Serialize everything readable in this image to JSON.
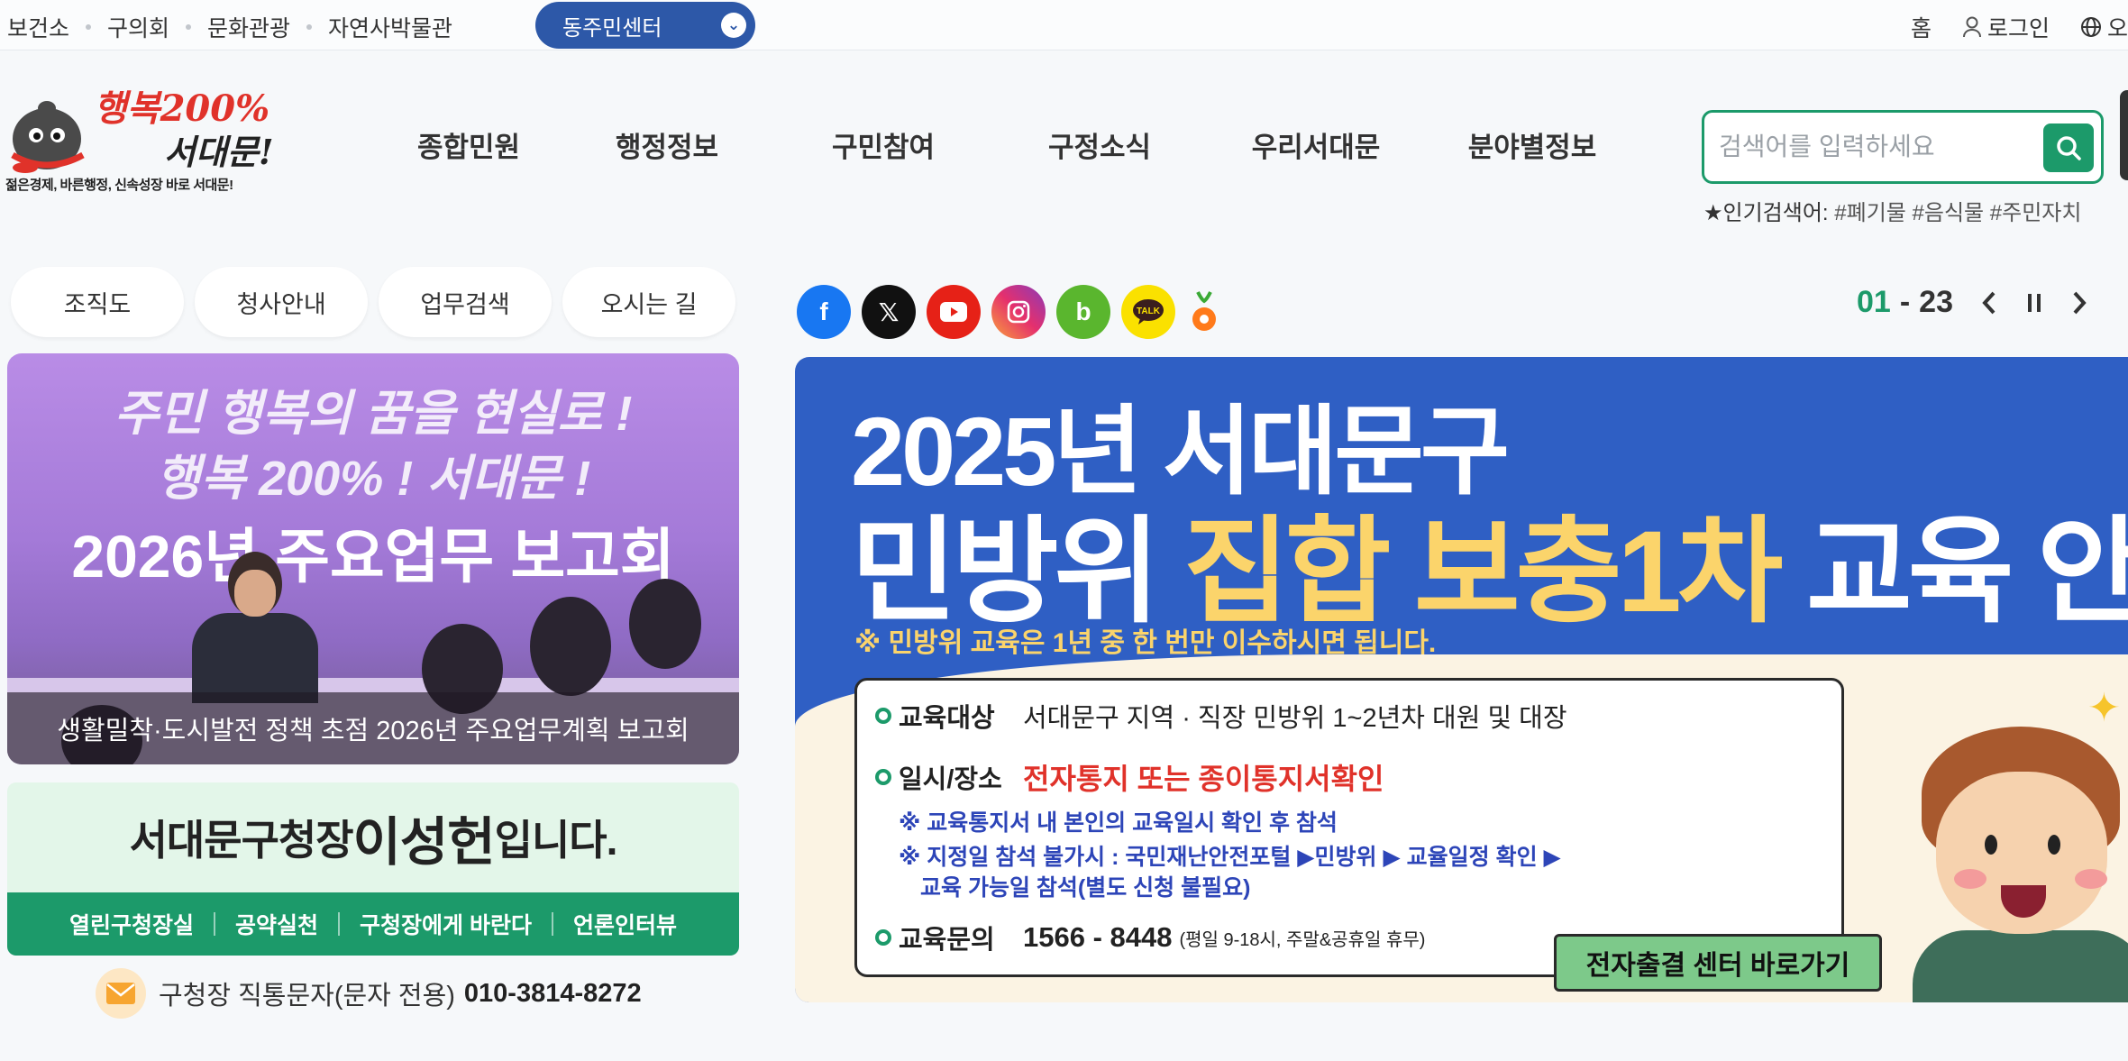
{
  "topbar": {
    "links": [
      "보건소",
      "구의회",
      "문화관광",
      "자연사박물관"
    ],
    "site_select": "동주민센터",
    "home": "홈",
    "login": "로그인",
    "lang": "오"
  },
  "header": {
    "logo_line1": "행복200%",
    "logo_line2": "서대문!",
    "logo_line3": "젊은경제, 바른행정, 신속성장 바로 서대문!",
    "menu": [
      "종합민원",
      "행정정보",
      "구민참여",
      "구정소식",
      "우리서대문",
      "분야별정보"
    ],
    "search_placeholder": "검색어를 입력하세요",
    "popular_label": "★인기검색어:",
    "popular_tags": "#폐기물 #음식물 #주민자치"
  },
  "quick": [
    "조직도",
    "청사안내",
    "업무검색",
    "오시는 길"
  ],
  "photo": {
    "banner1": "주민 행복의 꿈을 현실로 !",
    "banner2": "행복 200% ! 서대문 !",
    "banner3": "2026년 주요업무 보고회",
    "caption": "생활밀착·도시발전 정책 초점 2026년 주요업무계획 보고회"
  },
  "mayor": {
    "prefix": "서대문구청장 ",
    "name": "이성헌",
    "suffix": "입니다.",
    "links": [
      "열린구청장실",
      "공약실천",
      "구청장에게 바란다",
      "언론인터뷰"
    ],
    "sms_label": "구청장 직통문자(문자 전용)",
    "sms_number": "010-3814-8272"
  },
  "social": [
    "facebook",
    "x",
    "youtube",
    "instagram",
    "blog",
    "kakaotalk",
    "carrot"
  ],
  "pager": {
    "current": "01",
    "total": "23"
  },
  "banner": {
    "title1": "2025년 서대문구",
    "title2_white1": "민방위 ",
    "title2_yellow": "집합 보충1차",
    "title2_white2": " 교육 안내",
    "note": "※ 민방위 교육은 1년 중 한 번만 이수하시면 됩니다.",
    "row1_label": "교육대상",
    "row1_value": "서대문구 지역 · 직장 민방위 1~2년차 대원 및 대장",
    "row2_label": "일시/장소",
    "row2_value": "전자통지 또는 종이통지서확인",
    "sub1": "※ 교육통지서 내 본인의 교육일시 확인 후 참석",
    "sub2": "※ 지정일 참석 불가시 : 국민재난안전포털 ▶민방위 ▶ 교율일정 확인 ▶",
    "sub3": "교육 가능일 참석(별도 신청 불필요)",
    "row3_label": "교육문의",
    "row3_value": "1566 - 8448",
    "row3_small": "(평일 9-18시, 주말&공휴일 휴무)",
    "cta": "전자출결 센터 바로가기"
  },
  "colors": {
    "green": "#1c9a6a",
    "blue": "#2d58a8",
    "banner_blue": "#2f5fc4",
    "yellow": "#fbd46b"
  }
}
